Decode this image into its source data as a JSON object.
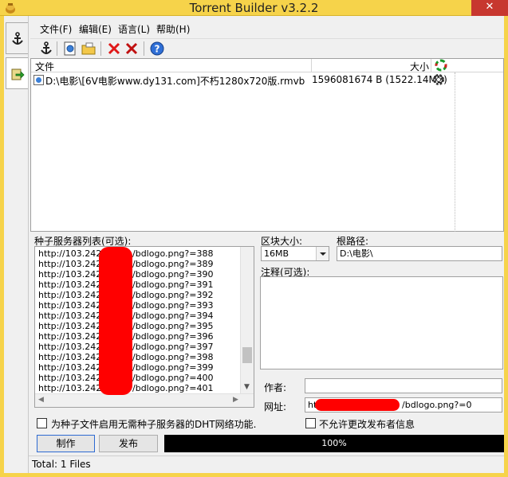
{
  "window": {
    "title": "Torrent Builder v3.2.2",
    "close_glyph": "✕"
  },
  "menu": [
    "文件(F)",
    "编辑(E)",
    "语言(L)",
    "帮助(H)"
  ],
  "toolbar_icons": [
    "anchor-icon",
    "new-file-icon",
    "open-folder-icon",
    "remove-icon",
    "remove-all-icon",
    "help-icon"
  ],
  "file_list": {
    "col_file": "文件",
    "col_size": "大小",
    "rows": [
      {
        "name": "D:\\电影\\[6V电影www.dy131.com]不朽1280x720版.rmvb",
        "size": "1596081674 B (1522.14MB)"
      }
    ]
  },
  "trackers": {
    "label": "种子服务器列表(可选):",
    "prefix": "http://103.242.",
    "items": [
      "/bdlogo.png?=388",
      "/bdlogo.png?=389",
      "/bdlogo.png?=390",
      "/bdlogo.png?=391",
      "/bdlogo.png?=392",
      "/bdlogo.png?=393",
      "/bdlogo.png?=394",
      "/bdlogo.png?=395",
      "/bdlogo.png?=396",
      "/bdlogo.png?=397",
      "/bdlogo.png?=398",
      "/bdlogo.png?=399",
      "/bdlogo.png?=400",
      "/bdlogo.png?=401"
    ]
  },
  "block_size": {
    "label": "区块大小:",
    "value": "16MB"
  },
  "root_path": {
    "label": "根路径:",
    "value": "D:\\电影\\"
  },
  "comment": {
    "label": "注释(可选):",
    "value": ""
  },
  "author": {
    "label": "作者:",
    "value": ""
  },
  "url": {
    "label": "网址:",
    "value_prefix": "htt",
    "value_suffix": "/bdlogo.png?=0"
  },
  "dht_checkbox": "为种子文件启用无需种子服务器的DHT网络功能.",
  "no_change_checkbox": "不允许更改发布者信息",
  "buttons": {
    "make": "制作",
    "publish": "发布"
  },
  "progress": {
    "text": "100%",
    "fraction": 1.0
  },
  "status": "Total: 1 Files",
  "colors": {
    "title_bar": "#f6d34a",
    "redaction": "#ff0000",
    "progress_bg": "#000000"
  }
}
